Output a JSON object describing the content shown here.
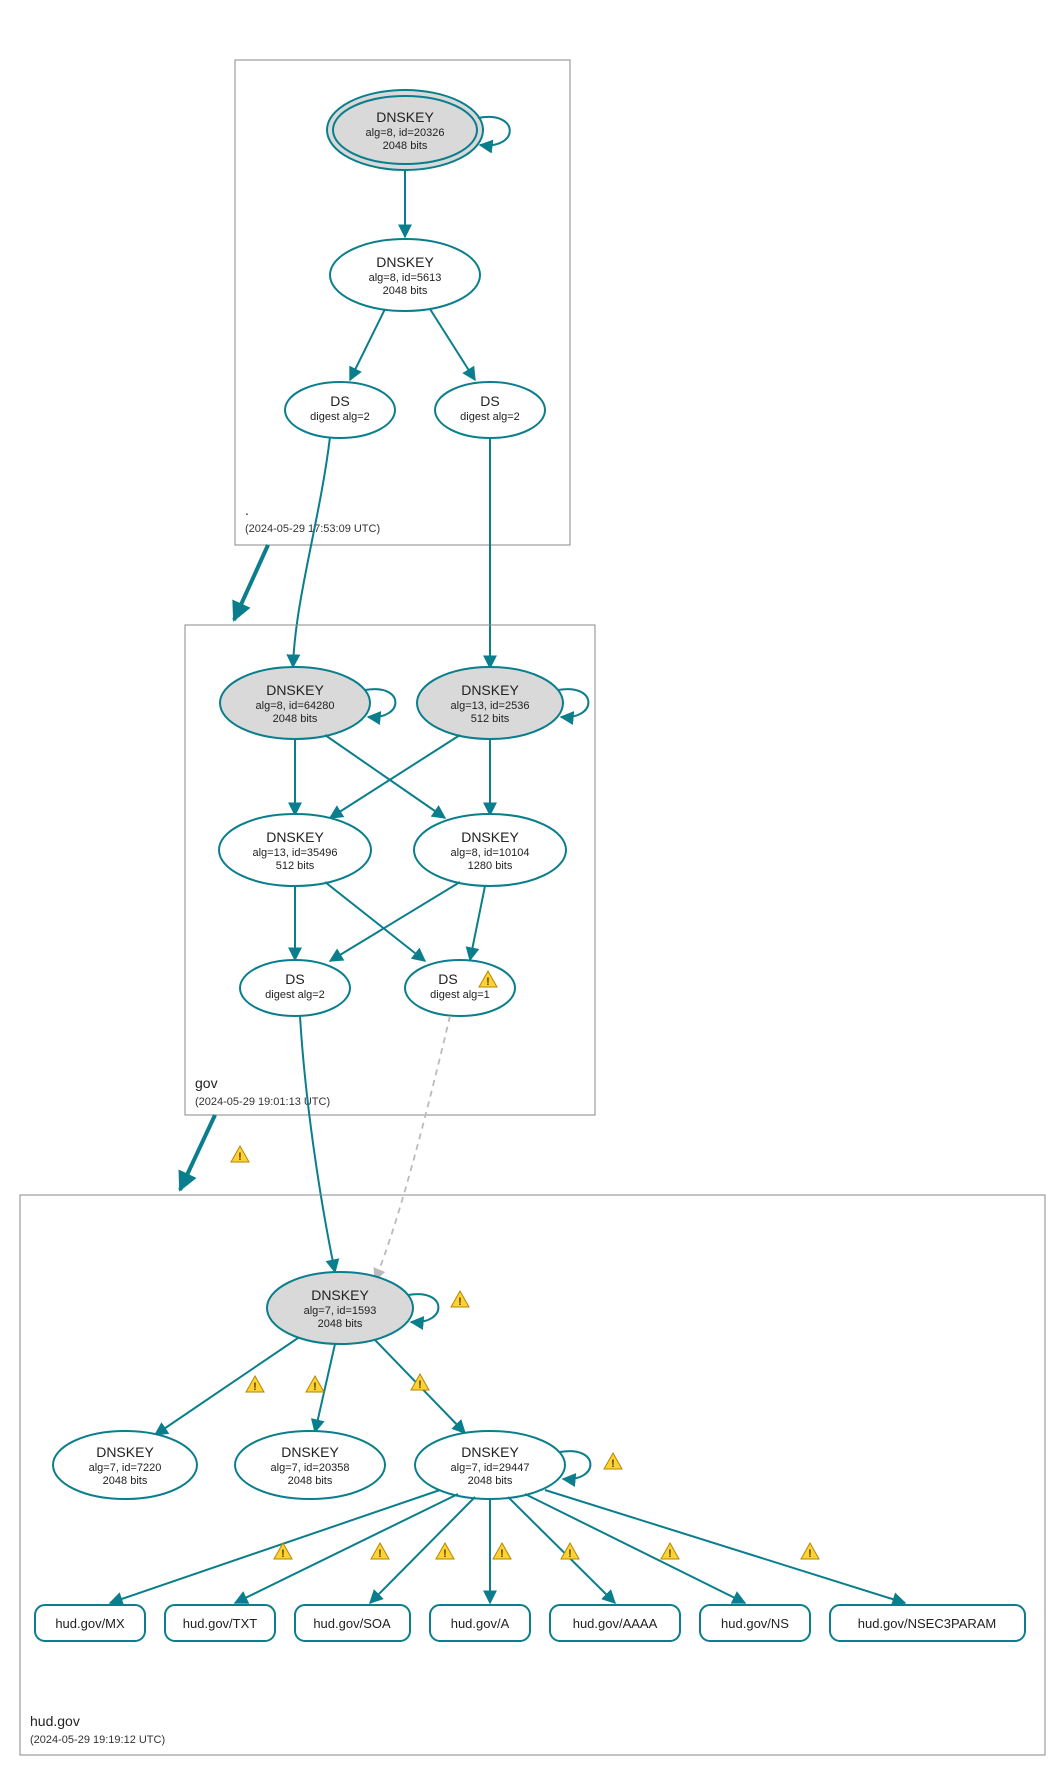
{
  "colors": {
    "stroke": "#0a7e8c",
    "ksk_fill": "#d9d9d9",
    "warn_fill": "#ffd233"
  },
  "zones": {
    "root": {
      "label": ".",
      "timestamp": "(2024-05-29 17:53:09 UTC)"
    },
    "gov": {
      "label": "gov",
      "timestamp": "(2024-05-29 19:01:13 UTC)"
    },
    "hudgov": {
      "label": "hud.gov",
      "timestamp": "(2024-05-29 19:19:12 UTC)"
    }
  },
  "nodes": {
    "root_ksk": {
      "title": "DNSKEY",
      "sub1": "alg=8, id=20326",
      "sub2": "2048 bits"
    },
    "root_zsk": {
      "title": "DNSKEY",
      "sub1": "alg=8, id=5613",
      "sub2": "2048 bits"
    },
    "root_ds_l": {
      "title": "DS",
      "sub1": "digest alg=2"
    },
    "root_ds_r": {
      "title": "DS",
      "sub1": "digest alg=2"
    },
    "gov_ksk_l": {
      "title": "DNSKEY",
      "sub1": "alg=8, id=64280",
      "sub2": "2048 bits"
    },
    "gov_ksk_r": {
      "title": "DNSKEY",
      "sub1": "alg=13, id=2536",
      "sub2": "512 bits"
    },
    "gov_zsk_l": {
      "title": "DNSKEY",
      "sub1": "alg=13, id=35496",
      "sub2": "512 bits"
    },
    "gov_zsk_r": {
      "title": "DNSKEY",
      "sub1": "alg=8, id=10104",
      "sub2": "1280 bits"
    },
    "gov_ds_l": {
      "title": "DS",
      "sub1": "digest alg=2"
    },
    "gov_ds_r": {
      "title": "DS",
      "sub1": "digest alg=1"
    },
    "hud_ksk": {
      "title": "DNSKEY",
      "sub1": "alg=7, id=1593",
      "sub2": "2048 bits"
    },
    "hud_zsk_1": {
      "title": "DNSKEY",
      "sub1": "alg=7, id=7220",
      "sub2": "2048 bits"
    },
    "hud_zsk_2": {
      "title": "DNSKEY",
      "sub1": "alg=7, id=20358",
      "sub2": "2048 bits"
    },
    "hud_zsk_3": {
      "title": "DNSKEY",
      "sub1": "alg=7, id=29447",
      "sub2": "2048 bits"
    }
  },
  "records": {
    "mx": {
      "label": "hud.gov/MX"
    },
    "txt": {
      "label": "hud.gov/TXT"
    },
    "soa": {
      "label": "hud.gov/SOA"
    },
    "a": {
      "label": "hud.gov/A"
    },
    "aaaa": {
      "label": "hud.gov/AAAA"
    },
    "ns": {
      "label": "hud.gov/NS"
    },
    "nsec3": {
      "label": "hud.gov/NSEC3PARAM"
    }
  },
  "chart_data": {
    "type": "graph",
    "description": "DNSSEC delegation/authentication graph for hud.gov",
    "zones": [
      {
        "name": ".",
        "queried": "2024-05-29 17:53:09 UTC"
      },
      {
        "name": "gov",
        "queried": "2024-05-29 19:01:13 UTC"
      },
      {
        "name": "hud.gov",
        "queried": "2024-05-29 19:19:12 UTC"
      }
    ],
    "nodes": [
      {
        "id": "root_ksk",
        "zone": ".",
        "type": "DNSKEY",
        "alg": 8,
        "key_id": 20326,
        "bits": 2048,
        "ksk": true,
        "self_loop": true
      },
      {
        "id": "root_zsk",
        "zone": ".",
        "type": "DNSKEY",
        "alg": 8,
        "key_id": 5613,
        "bits": 2048,
        "ksk": false
      },
      {
        "id": "root_ds_l",
        "zone": ".",
        "type": "DS",
        "digest_alg": 2
      },
      {
        "id": "root_ds_r",
        "zone": ".",
        "type": "DS",
        "digest_alg": 2
      },
      {
        "id": "gov_ksk_l",
        "zone": "gov",
        "type": "DNSKEY",
        "alg": 8,
        "key_id": 64280,
        "bits": 2048,
        "ksk": true,
        "self_loop": true
      },
      {
        "id": "gov_ksk_r",
        "zone": "gov",
        "type": "DNSKEY",
        "alg": 13,
        "key_id": 2536,
        "bits": 512,
        "ksk": true,
        "self_loop": true
      },
      {
        "id": "gov_zsk_l",
        "zone": "gov",
        "type": "DNSKEY",
        "alg": 13,
        "key_id": 35496,
        "bits": 512,
        "ksk": false
      },
      {
        "id": "gov_zsk_r",
        "zone": "gov",
        "type": "DNSKEY",
        "alg": 8,
        "key_id": 10104,
        "bits": 1280,
        "ksk": false
      },
      {
        "id": "gov_ds_l",
        "zone": "gov",
        "type": "DS",
        "digest_alg": 2
      },
      {
        "id": "gov_ds_r",
        "zone": "gov",
        "type": "DS",
        "digest_alg": 1,
        "warning": true
      },
      {
        "id": "hud_ksk",
        "zone": "hud.gov",
        "type": "DNSKEY",
        "alg": 7,
        "key_id": 1593,
        "bits": 2048,
        "ksk": true,
        "self_loop": true,
        "warning": true
      },
      {
        "id": "hud_zsk_1",
        "zone": "hud.gov",
        "type": "DNSKEY",
        "alg": 7,
        "key_id": 7220,
        "bits": 2048,
        "ksk": false
      },
      {
        "id": "hud_zsk_2",
        "zone": "hud.gov",
        "type": "DNSKEY",
        "alg": 7,
        "key_id": 20358,
        "bits": 2048,
        "ksk": false
      },
      {
        "id": "hud_zsk_3",
        "zone": "hud.gov",
        "type": "DNSKEY",
        "alg": 7,
        "key_id": 29447,
        "bits": 2048,
        "ksk": false,
        "self_loop": true,
        "warning": true
      },
      {
        "id": "rr_mx",
        "zone": "hud.gov",
        "type": "RRset",
        "name": "hud.gov/MX"
      },
      {
        "id": "rr_txt",
        "zone": "hud.gov",
        "type": "RRset",
        "name": "hud.gov/TXT"
      },
      {
        "id": "rr_soa",
        "zone": "hud.gov",
        "type": "RRset",
        "name": "hud.gov/SOA"
      },
      {
        "id": "rr_a",
        "zone": "hud.gov",
        "type": "RRset",
        "name": "hud.gov/A"
      },
      {
        "id": "rr_aaaa",
        "zone": "hud.gov",
        "type": "RRset",
        "name": "hud.gov/AAAA"
      },
      {
        "id": "rr_ns",
        "zone": "hud.gov",
        "type": "RRset",
        "name": "hud.gov/NS"
      },
      {
        "id": "rr_nsec3",
        "zone": "hud.gov",
        "type": "RRset",
        "name": "hud.gov/NSEC3PARAM"
      }
    ],
    "edges": [
      {
        "from": "root_ksk",
        "to": "root_zsk"
      },
      {
        "from": "root_zsk",
        "to": "root_ds_l"
      },
      {
        "from": "root_zsk",
        "to": "root_ds_r"
      },
      {
        "from": "root_ds_l",
        "to": "gov_ksk_l"
      },
      {
        "from": "root_ds_r",
        "to": "gov_ksk_r"
      },
      {
        "from": "gov_ksk_l",
        "to": "gov_zsk_l"
      },
      {
        "from": "gov_ksk_l",
        "to": "gov_zsk_r"
      },
      {
        "from": "gov_ksk_r",
        "to": "gov_zsk_l"
      },
      {
        "from": "gov_ksk_r",
        "to": "gov_zsk_r"
      },
      {
        "from": "gov_zsk_l",
        "to": "gov_ds_l"
      },
      {
        "from": "gov_zsk_l",
        "to": "gov_ds_r"
      },
      {
        "from": "gov_zsk_r",
        "to": "gov_ds_l"
      },
      {
        "from": "gov_zsk_r",
        "to": "gov_ds_r"
      },
      {
        "from": "gov_ds_l",
        "to": "hud_ksk"
      },
      {
        "from": "gov_ds_r",
        "to": "hud_ksk",
        "style": "dashed"
      },
      {
        "from": "hud_ksk",
        "to": "hud_zsk_1",
        "warning": true
      },
      {
        "from": "hud_ksk",
        "to": "hud_zsk_2",
        "warning": true
      },
      {
        "from": "hud_ksk",
        "to": "hud_zsk_3",
        "warning": true
      },
      {
        "from": "hud_zsk_3",
        "to": "rr_mx",
        "warning": true
      },
      {
        "from": "hud_zsk_3",
        "to": "rr_txt",
        "warning": true
      },
      {
        "from": "hud_zsk_3",
        "to": "rr_soa",
        "warning": true
      },
      {
        "from": "hud_zsk_3",
        "to": "rr_a",
        "warning": true
      },
      {
        "from": "hud_zsk_3",
        "to": "rr_aaaa",
        "warning": true
      },
      {
        "from": "hud_zsk_3",
        "to": "rr_ns",
        "warning": true
      },
      {
        "from": "hud_zsk_3",
        "to": "rr_nsec3",
        "warning": true
      }
    ],
    "delegations": [
      {
        "from_zone": ".",
        "to_zone": "gov",
        "warning": false
      },
      {
        "from_zone": "gov",
        "to_zone": "hud.gov",
        "warning": true
      }
    ]
  }
}
